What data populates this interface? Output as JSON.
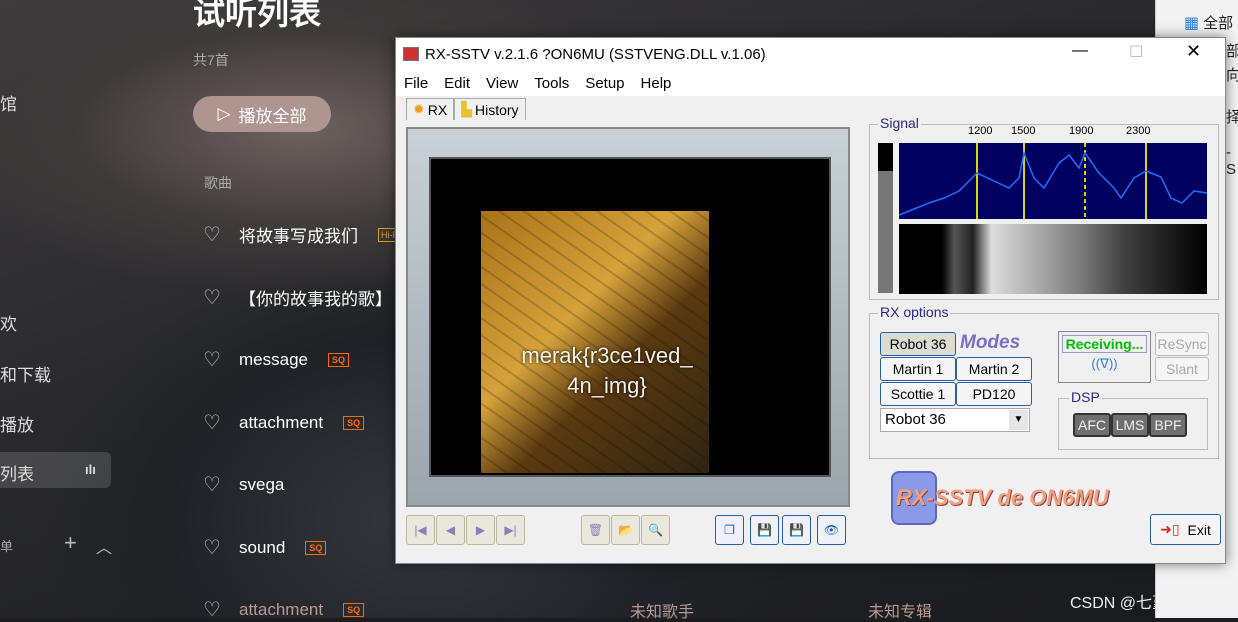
{
  "music_app": {
    "sidebar": [
      {
        "label": "馆"
      },
      {
        "label": "欢"
      },
      {
        "label": "和下载"
      },
      {
        "label": "播放"
      },
      {
        "label": "列表"
      },
      {
        "label": "单"
      }
    ],
    "title": "试听列表",
    "count": "共7首",
    "play_all": "播放全部",
    "column_song": "歌曲",
    "songs": [
      {
        "name": "将故事写成我们",
        "badge": "Hi-Res"
      },
      {
        "name": "【你的故事我的歌】",
        "badge": ""
      },
      {
        "name": "message",
        "badge": "SQ"
      },
      {
        "name": "attachment",
        "badge": "SQ"
      },
      {
        "name": "svega",
        "badge": ""
      },
      {
        "name": "sound",
        "badge": "SQ"
      },
      {
        "name": "attachment",
        "badge": "SQ",
        "artist": "未知歌手",
        "album": "未知专辑"
      }
    ]
  },
  "right_panel": {
    "items": [
      "全部",
      "部",
      "向",
      "择",
      "-S"
    ]
  },
  "watermark": "CSDN @七堇墨年",
  "window": {
    "title": "RX-SSTV v.2.1.6 ?ON6MU (SSTVENG.DLL v.1.06)",
    "menu": [
      "File",
      "Edit",
      "View",
      "Tools",
      "Setup",
      "Help"
    ],
    "tabs": [
      "RX",
      "History"
    ],
    "image_text": [
      "merak{r3ce1ved_",
      "4n_img}"
    ],
    "signal": {
      "label": "Signal",
      "ticks": [
        "1200",
        "1500",
        "1900",
        "2300"
      ]
    },
    "rx_options": {
      "label": "RX options",
      "modes": [
        "Robot 36",
        "Martin 1",
        "Martin 2",
        "Scottie 1",
        "PD120"
      ],
      "modes_logo": "Modes",
      "selected_mode": "Robot 36",
      "status": "Receiving...",
      "resync": "ReSync",
      "slant": "Slant"
    },
    "dsp": {
      "label": "DSP",
      "buttons": [
        "AFC",
        "LMS",
        "BPF"
      ]
    },
    "logo": "RX-SSTV de ON6MU",
    "exit": "Exit",
    "accent": "#00c000"
  }
}
